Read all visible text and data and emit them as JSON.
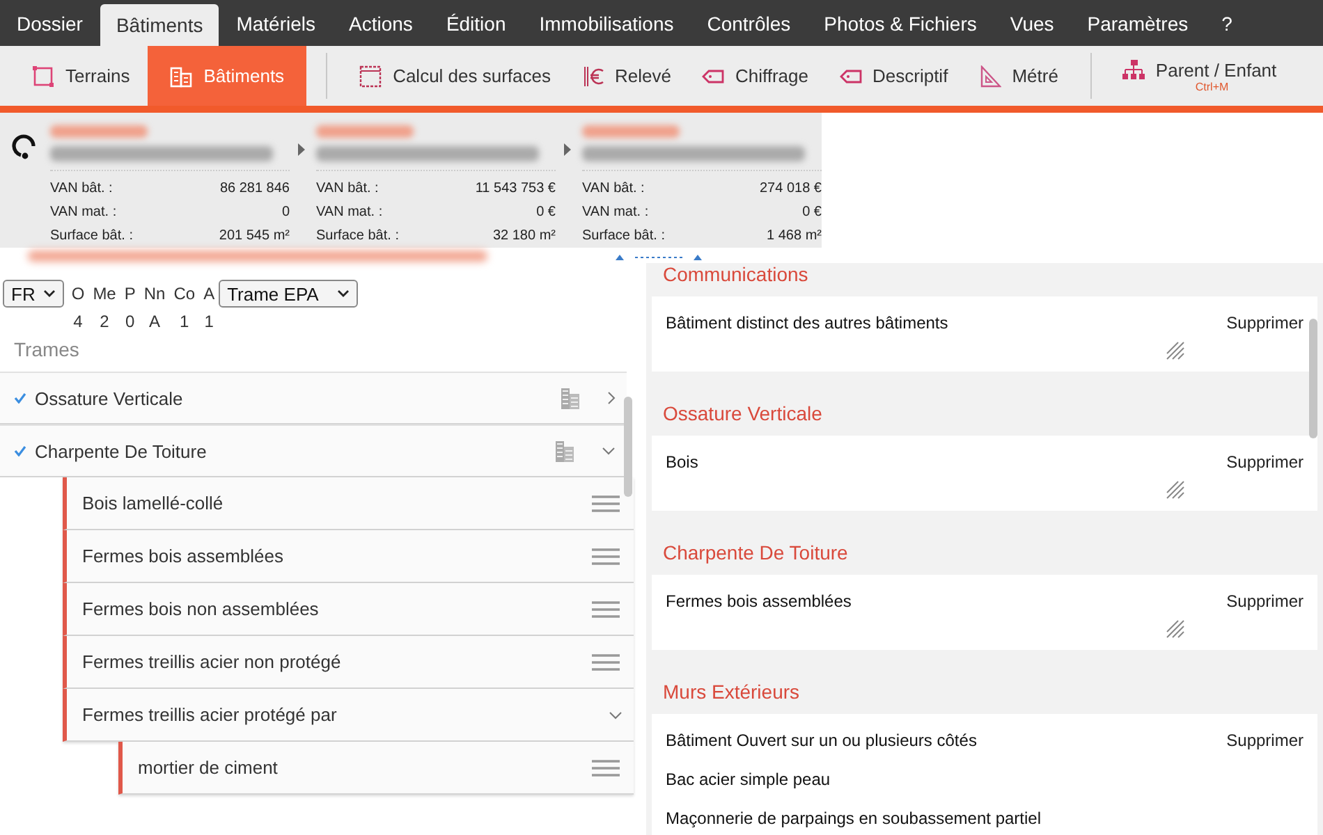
{
  "menu": [
    {
      "label": "Dossier",
      "selected": false
    },
    {
      "label": "Bâtiments",
      "selected": true
    },
    {
      "label": "Matériels",
      "selected": false
    },
    {
      "label": "Actions",
      "selected": false
    },
    {
      "label": "Édition",
      "selected": false
    },
    {
      "label": "Immobilisations",
      "selected": false
    },
    {
      "label": "Contrôles",
      "selected": false
    },
    {
      "label": "Photos & Fichiers",
      "selected": false
    },
    {
      "label": "Vues",
      "selected": false
    },
    {
      "label": "Paramètres",
      "selected": false
    },
    {
      "label": "?",
      "selected": false
    }
  ],
  "toolbar": {
    "groups": [
      [
        {
          "label": "Terrains",
          "kind": "plot",
          "selected": false
        },
        {
          "label": "Bâtiments",
          "kind": "building",
          "selected": true
        }
      ],
      [
        {
          "label": "Calcul des surfaces",
          "kind": "ruler",
          "selected": false
        },
        {
          "label": "Relevé",
          "kind": "euro",
          "selected": false
        },
        {
          "label": "Chiffrage",
          "kind": "tag",
          "selected": false
        },
        {
          "label": "Descriptif",
          "kind": "tag",
          "selected": false
        },
        {
          "label": "Métré",
          "kind": "setsquare",
          "selected": false
        }
      ]
    ],
    "parent_child": {
      "label": "Parent / Enfant",
      "shortcut": "Ctrl+M"
    }
  },
  "summary": {
    "columns": [
      {
        "stats": [
          {
            "label": "VAN bât. :",
            "value": "86 281 846"
          },
          {
            "label": "VAN mat. :",
            "value": "0"
          },
          {
            "label": "Surface bât. :",
            "value": "201 545 m²"
          }
        ]
      },
      {
        "stats": [
          {
            "label": "VAN bât. :",
            "value": "11 543 753 €"
          },
          {
            "label": "VAN mat. :",
            "value": "0 €"
          },
          {
            "label": "Surface bât. :",
            "value": "32 180 m²"
          }
        ]
      },
      {
        "stats": [
          {
            "label": "VAN bât. :",
            "value": "274 018 €"
          },
          {
            "label": "VAN mat. :",
            "value": "0 €"
          },
          {
            "label": "Surface bât. :",
            "value": "1 468 m²"
          }
        ]
      }
    ]
  },
  "filters": {
    "language": "FR",
    "codes": [
      {
        "code": "O",
        "value": "4"
      },
      {
        "code": "Me",
        "value": "2"
      },
      {
        "code": "P",
        "value": "0"
      },
      {
        "code": "Nn",
        "value": "A"
      },
      {
        "code": "Co",
        "value": "1"
      },
      {
        "code": "A",
        "value": "1"
      }
    ],
    "trame": "Trame EPA"
  },
  "trames": {
    "heading": "Trames",
    "items": [
      {
        "label": "Ossature Verticale",
        "checked": true,
        "expanded": false
      },
      {
        "label": "Charpente De Toiture",
        "checked": true,
        "expanded": true,
        "children": [
          {
            "label": "Bois lamellé-collé"
          },
          {
            "label": "Fermes bois assemblées"
          },
          {
            "label": "Fermes bois non assemblées"
          },
          {
            "label": "Fermes treillis acier non protégé"
          },
          {
            "label": "Fermes treillis acier protégé par",
            "expanded": true,
            "children": [
              {
                "label": "mortier de ciment"
              }
            ]
          }
        ]
      }
    ]
  },
  "description": {
    "sections": [
      {
        "title": "Communications",
        "lines": [
          "Bâtiment distinct des autres bâtiments"
        ],
        "action": "Supprimer",
        "resizable": true
      },
      {
        "title": "Ossature Verticale",
        "lines": [
          "Bois"
        ],
        "action": "Supprimer",
        "resizable": true
      },
      {
        "title": "Charpente De Toiture",
        "lines": [
          "Fermes bois assemblées"
        ],
        "action": "Supprimer",
        "resizable": true
      },
      {
        "title": "Murs Extérieurs",
        "lines": [
          "Bâtiment Ouvert sur un ou plusieurs côtés",
          "Bac acier simple peau",
          "Maçonnerie de parpaings  en soubassement partiel"
        ],
        "action": "Supprimer",
        "resizable": false
      }
    ]
  }
}
